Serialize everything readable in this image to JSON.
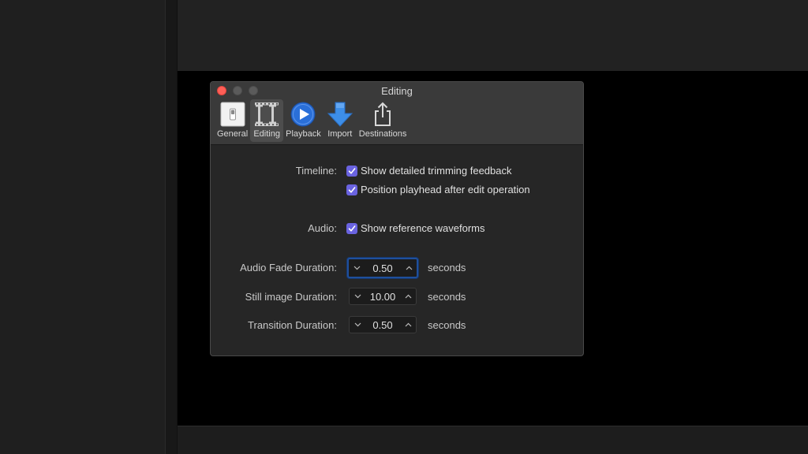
{
  "window": {
    "title": "Editing"
  },
  "toolbar": {
    "items": [
      {
        "label": "General",
        "icon": "switch-icon"
      },
      {
        "label": "Editing",
        "icon": "trim-icon"
      },
      {
        "label": "Playback",
        "icon": "play-icon"
      },
      {
        "label": "Import",
        "icon": "download-arrow-icon"
      },
      {
        "label": "Destinations",
        "icon": "share-icon"
      }
    ],
    "selected": "Editing"
  },
  "timeline": {
    "label": "Timeline:",
    "show_trimming_feedback": {
      "label": "Show detailed trimming feedback",
      "checked": true
    },
    "position_playhead": {
      "label": "Position playhead after edit operation",
      "checked": true
    }
  },
  "audio": {
    "label": "Audio:",
    "show_waveforms": {
      "label": "Show reference waveforms",
      "checked": true
    }
  },
  "durations": {
    "audio_fade": {
      "label": "Audio Fade Duration:",
      "value": "0.50",
      "unit": "seconds"
    },
    "still_image": {
      "label": "Still image Duration:",
      "value": "10.00",
      "unit": "seconds"
    },
    "transition": {
      "label": "Transition Duration:",
      "value": "0.50",
      "unit": "seconds"
    }
  },
  "colors": {
    "checkbox": "#6a63e0",
    "close_button": "#fe5f57",
    "focus_ring": "#1f4f9c",
    "play_blue": "#2a6fd8"
  }
}
